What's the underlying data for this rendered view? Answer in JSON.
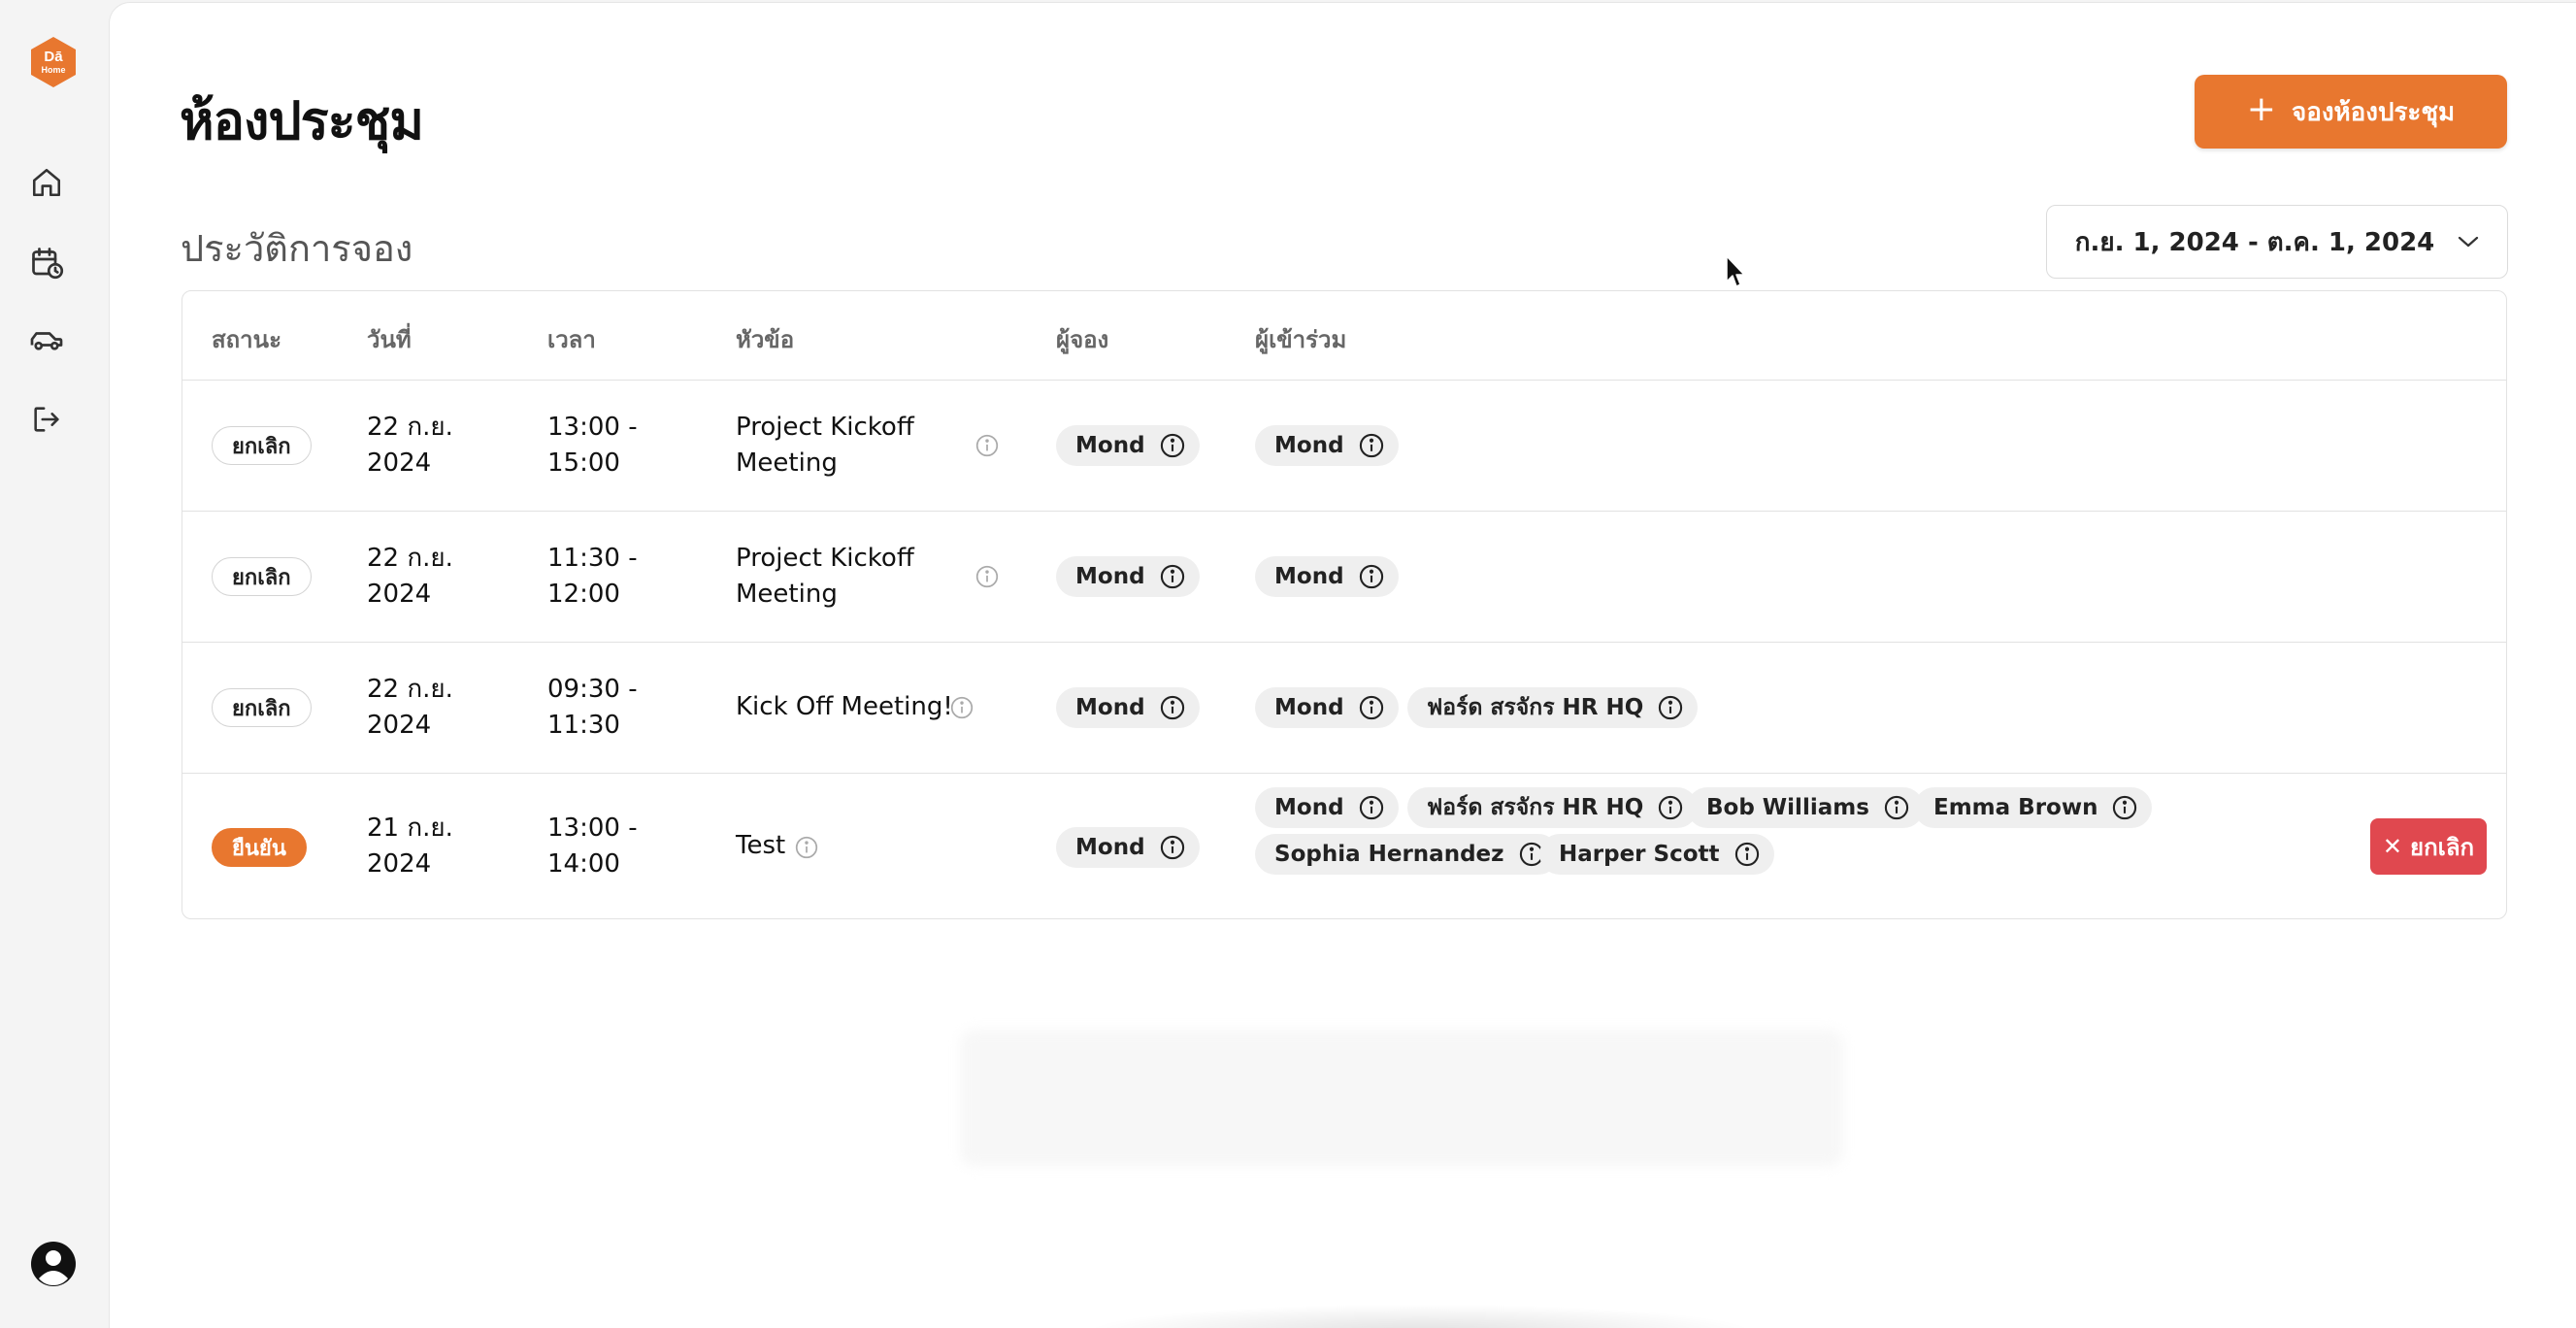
{
  "sidebar": {
    "logo_text": "Dā Home",
    "items": [
      {
        "icon": "home-icon"
      },
      {
        "icon": "calendar-clock-icon"
      },
      {
        "icon": "car-icon"
      },
      {
        "icon": "logout-icon"
      }
    ],
    "avatar_icon": "user-avatar-icon"
  },
  "header": {
    "title": "ห้องประชุม",
    "book_button_label": "จองห้องประชุม"
  },
  "history": {
    "section_title": "ประวัติการจอง",
    "date_range": "ก.ย. 1, 2024 - ต.ค. 1, 2024"
  },
  "table": {
    "columns": [
      "สถานะ",
      "วันที่",
      "เวลา",
      "หัวข้อ",
      "ผู้จอง",
      "ผู้เข้าร่วม"
    ],
    "rows": [
      {
        "status": "ยกเลิก",
        "status_type": "cancelled",
        "date_line1": "22 ก.ย.",
        "date_line2": "2024",
        "time_line1": "13:00 -",
        "time_line2": "15:00",
        "topic_line1": "Project Kickoff",
        "topic_line2": "Meeting",
        "booker": "Mond",
        "attendees": [
          "Mond"
        ]
      },
      {
        "status": "ยกเลิก",
        "status_type": "cancelled",
        "date_line1": "22 ก.ย.",
        "date_line2": "2024",
        "time_line1": "11:30 -",
        "time_line2": "12:00",
        "topic_line1": "Project Kickoff",
        "topic_line2": "Meeting",
        "booker": "Mond",
        "attendees": [
          "Mond"
        ]
      },
      {
        "status": "ยกเลิก",
        "status_type": "cancelled",
        "date_line1": "22 ก.ย.",
        "date_line2": "2024",
        "time_line1": "09:30 -",
        "time_line2": "11:30",
        "topic_line1": "Kick Off Meeting!",
        "booker": "Mond",
        "attendees": [
          "Mond",
          "ฟอร์ด สรจักร HR HQ"
        ]
      },
      {
        "status": "ยืนยัน",
        "status_type": "confirmed",
        "date_line1": "21 ก.ย.",
        "date_line2": "2024",
        "time_line1": "13:00 -",
        "time_line2": "14:00",
        "topic_line1": "Test",
        "booker": "Mond",
        "attendees": [
          "Mond",
          "ฟอร์ด สรจักร HR HQ",
          "Bob Williams",
          "Emma Brown",
          "Sophia Hernandez",
          "Harper Scott"
        ],
        "action_label": "ยกเลิก"
      }
    ]
  },
  "colors": {
    "accent": "#e8772f",
    "danger": "#e0484f",
    "chip_bg": "#efefef"
  }
}
